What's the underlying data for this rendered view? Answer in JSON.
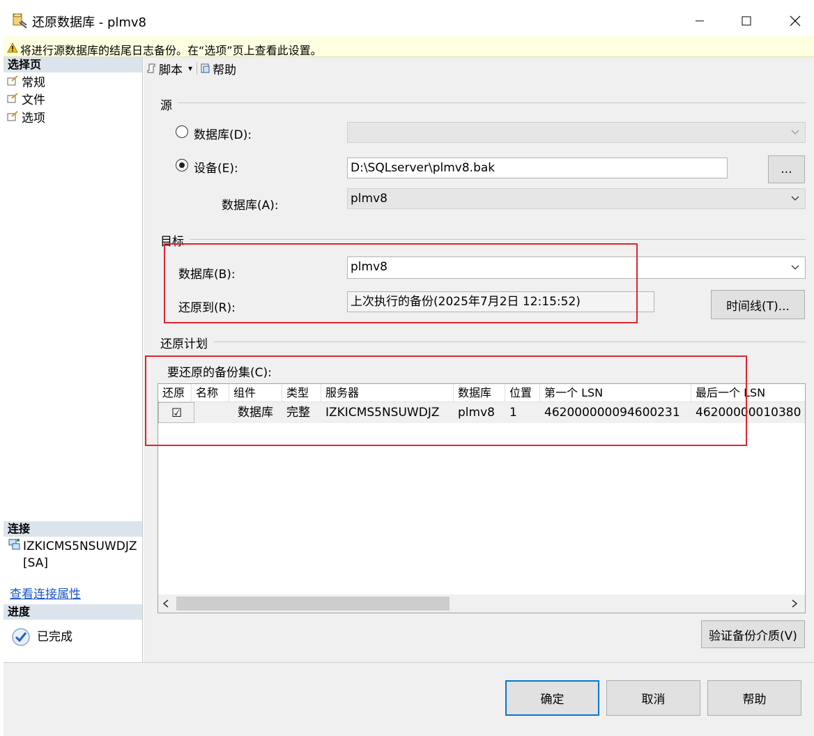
{
  "window": {
    "title": "还原数据库 - plmv8",
    "minimize": "—",
    "maximize": "☐",
    "close": "✕"
  },
  "warning": {
    "icon": "warning-icon",
    "text": "将进行源数据库的结尾日志备份。在“选项”页上查看此设置。"
  },
  "left": {
    "select_page_header": "选择页",
    "pages": [
      {
        "label": "常规",
        "icon": "page-icon"
      },
      {
        "label": "文件",
        "icon": "page-icon"
      },
      {
        "label": "选项",
        "icon": "page-icon"
      }
    ],
    "connection_header": "连接",
    "connection_server": "IZKICMS5NSUWDJZ [SA]",
    "connection_link": "查看连接属性",
    "progress_header": "进度",
    "progress_status": "已完成"
  },
  "toolbar": {
    "script_label": "脚本",
    "script_dropdown": "▾",
    "help_label": "帮助"
  },
  "source": {
    "group_label": "源",
    "database_radio_label": "数据库(D):",
    "database_value": "",
    "device_radio_label": "设备(E):",
    "device_value": "D:\\SQLserver\\plmv8.bak",
    "browse_label": "...",
    "database_a_label": "数据库(A):",
    "database_a_value": "plmv8",
    "selected": "device"
  },
  "target": {
    "group_label": "目标",
    "database_label": "数据库(B):",
    "database_value": "plmv8",
    "restore_to_label": "还原到(R):",
    "restore_to_value": "上次执行的备份(2025年7月2日 12:15:52)",
    "timeline_label": "时间线(T)..."
  },
  "plan": {
    "group_label": "还原计划",
    "backup_sets_label": "要还原的备份集(C):",
    "columns": [
      "还原",
      "名称",
      "组件",
      "类型",
      "服务器",
      "数据库",
      "位置",
      "第一个 LSN",
      "最后一个 LSN"
    ],
    "rows": [
      {
        "restore": "☑",
        "name": "",
        "component": "数据库",
        "type": "完整",
        "server": "IZKICMS5NSUWDJZ",
        "database": "plmv8",
        "position": "1",
        "first_lsn": "462000000094600231",
        "last_lsn": "46200000010380"
      }
    ],
    "verify_label": "验证备份介质(V)"
  },
  "buttons": {
    "ok": "确定",
    "cancel": "取消",
    "help": "帮助"
  },
  "colors": {
    "highlight": "#e0242c",
    "link": "#1a56c8",
    "warning_bg": "#ffffe1",
    "default_button_border": "#0078d7"
  }
}
